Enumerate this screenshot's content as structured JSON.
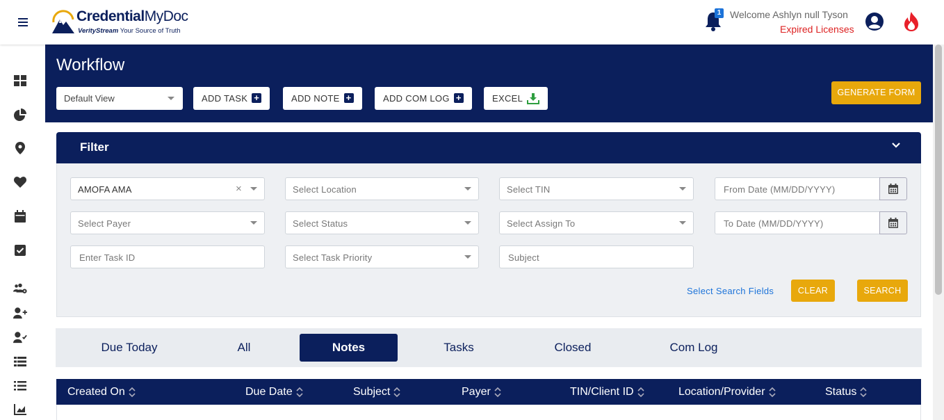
{
  "app": {
    "logo_main": "Credential",
    "logo_light": "MyDoc",
    "logo_brand": "VerityStream",
    "logo_tagline": "Your Source of Truth"
  },
  "header": {
    "notification_count": "1",
    "welcome": "Welcome Ashlyn null Tyson",
    "expired": "Expired Licenses"
  },
  "sidebar": {
    "icons": [
      "dashboard-icon",
      "pie-chart-icon",
      "location-pin-icon",
      "heart-icon",
      "calendar-icon",
      "checkbox-icon",
      "users-gear-icon",
      "user-plus-icon",
      "user-check-icon",
      "table-icon",
      "list-icon",
      "chart-icon"
    ]
  },
  "workflow": {
    "title": "Workflow",
    "view_select": "Default View",
    "buttons": {
      "add_task": "ADD TASK",
      "add_note": "ADD NOTE",
      "add_com_log": "ADD COM LOG",
      "excel": "EXCEL",
      "generate_form": "GENERATE FORM"
    }
  },
  "filter": {
    "title": "Filter",
    "provider_value": "AMOFA AMA",
    "location_placeholder": "Select Location",
    "tin_placeholder": "Select TIN",
    "from_date_placeholder": "From Date (MM/DD/YYYY)",
    "payer_placeholder": "Select Payer",
    "status_placeholder": "Select Status",
    "assign_placeholder": "Select Assign To",
    "to_date_placeholder": "To Date (MM/DD/YYYY)",
    "task_id_placeholder": "Enter Task ID",
    "priority_placeholder": "Select Task Priority",
    "subject_placeholder": "Subject",
    "search_fields_link": "Select Search Fields",
    "clear": "CLEAR",
    "search": "SEARCH"
  },
  "tabs": [
    {
      "label": "Due Today",
      "active": false
    },
    {
      "label": "All",
      "active": false
    },
    {
      "label": "Notes",
      "active": true
    },
    {
      "label": "Tasks",
      "active": false
    },
    {
      "label": "Closed",
      "active": false
    },
    {
      "label": "Com Log",
      "active": false
    }
  ],
  "table": {
    "columns": [
      "Created On",
      "Due Date",
      "Subject",
      "Payer",
      "TIN/Client ID",
      "Location/Provider",
      "Status"
    ]
  },
  "colors": {
    "navy": "#0b1f5c",
    "accent": "#e8a80c",
    "alert": "#dd2222",
    "link": "#1c73d9"
  }
}
